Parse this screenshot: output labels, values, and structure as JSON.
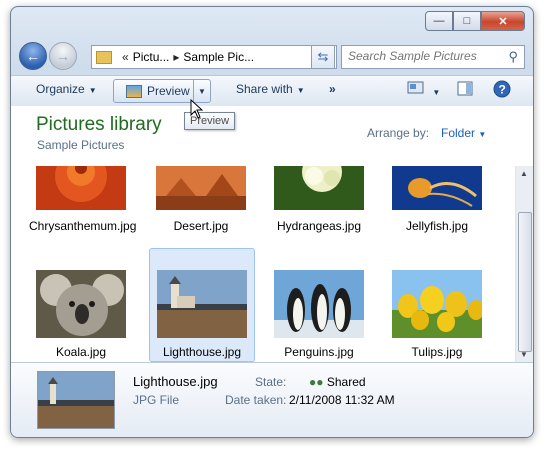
{
  "address": {
    "crumb1": "Pictu...",
    "crumb2": "Sample Pic..."
  },
  "search": {
    "placeholder": "Search Sample Pictures"
  },
  "toolbar": {
    "organize": "Organize",
    "preview": "Preview",
    "share": "Share with",
    "more": "»"
  },
  "tooltip": "Preview",
  "library": {
    "title": "Pictures library",
    "subtitle": "Sample Pictures",
    "arrange_label": "Arrange by:",
    "arrange_value": "Folder"
  },
  "files_row1": [
    "Chrysanthemum.jpg",
    "Desert.jpg",
    "Hydrangeas.jpg",
    "Jellyfish.jpg"
  ],
  "files_row2": [
    "Koala.jpg",
    "Lighthouse.jpg",
    "Penguins.jpg",
    "Tulips.jpg"
  ],
  "details": {
    "name": "Lighthouse.jpg",
    "type": "JPG File",
    "state_label": "State:",
    "state_value": "Shared",
    "date_label": "Date taken:",
    "date_value": "2/11/2008 11:32 AM"
  },
  "colors": {
    "library_title": "#1f6b1f",
    "link": "#1a5fbf",
    "selection": "#dbe9fa"
  }
}
